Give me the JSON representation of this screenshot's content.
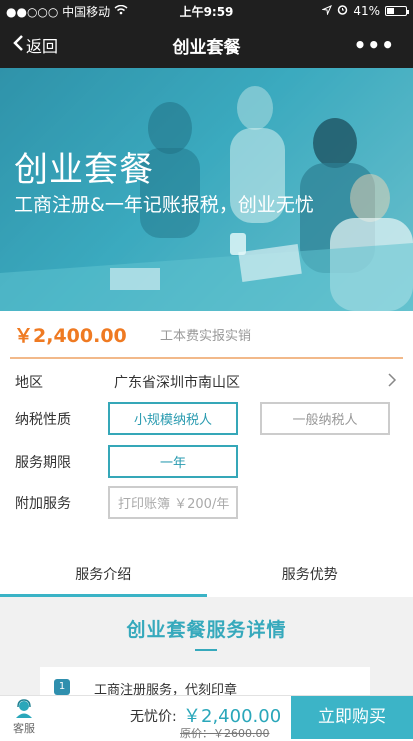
{
  "status_bar": {
    "carrier": "●●○○○ 中国移动",
    "time": "上午9:59",
    "battery": "41%",
    "battery_level": 0.41
  },
  "nav": {
    "back_label": "返回",
    "title": "创业套餐",
    "more_label": "•••"
  },
  "hero": {
    "title": "创业套餐",
    "subtitle": "工商注册&一年记账报税，创业无忧"
  },
  "price": {
    "amount": "￥2,400.00",
    "note": "工本费实报实销"
  },
  "form": {
    "region": {
      "label": "地区",
      "value": "广东省深圳市南山区"
    },
    "tax": {
      "label": "纳税性质",
      "options": [
        "小规模纳税人",
        "一般纳税人"
      ],
      "selected": "小规模纳税人"
    },
    "term": {
      "label": "服务期限",
      "options": [
        "一年"
      ],
      "selected": "一年"
    },
    "addon": {
      "label": "附加服务",
      "placeholder": "打印账簿 ￥200/年"
    }
  },
  "tabs": [
    {
      "label": "服务介绍",
      "active": true
    },
    {
      "label": "服务优势",
      "active": false
    }
  ],
  "detail": {
    "title": "创业套餐服务详情",
    "items": [
      {
        "num": "1",
        "text": "工商注册服务，代刻印章"
      }
    ]
  },
  "bottom": {
    "service_label": "客服",
    "wuyou_label": "无忧价:",
    "wuyou_price": "￥2,400.00",
    "original_price": "原价：￥2600.00",
    "buy_label": "立即购买"
  },
  "colors": {
    "accent": "#3cb4c7",
    "price_orange": "#ef7a22",
    "bar_dark": "#1f1f1f"
  }
}
